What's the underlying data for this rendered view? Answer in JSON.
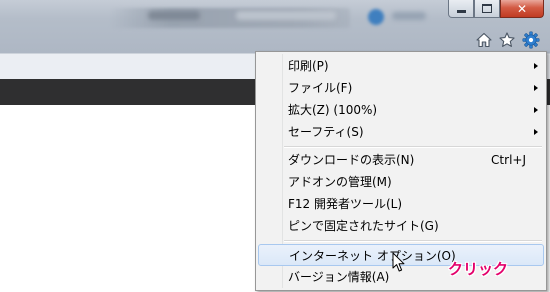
{
  "toolbar_icons": [
    "home-icon",
    "star-icon",
    "gear-icon"
  ],
  "window_controls": [
    "minimize",
    "maximize",
    "close"
  ],
  "colors": {
    "close_button": "#c03b22",
    "gear_icon": "#2f7fd0",
    "annotation": "#e3006b",
    "menu_background": "#f2f2f2",
    "menu_highlight": "#dbe8f8"
  },
  "tools_menu": {
    "items": [
      {
        "label": "印刷(P)",
        "submenu": true
      },
      {
        "label": "ファイル(F)",
        "submenu": true
      },
      {
        "label": "拡大(Z) (100%)",
        "submenu": true
      },
      {
        "label": "セーフティ(S)",
        "submenu": true
      },
      {
        "label": "ダウンロードの表示(N)",
        "shortcut": "Ctrl+J"
      },
      {
        "label": "アドオンの管理(M)"
      },
      {
        "label": "F12 開発者ツール(L)"
      },
      {
        "label": "ピンで固定されたサイト(G)"
      },
      {
        "label": "インターネット オプション(O)",
        "highlighted": true
      },
      {
        "label": "バージョン情報(A)"
      }
    ]
  },
  "annotation": {
    "text": "クリック"
  }
}
